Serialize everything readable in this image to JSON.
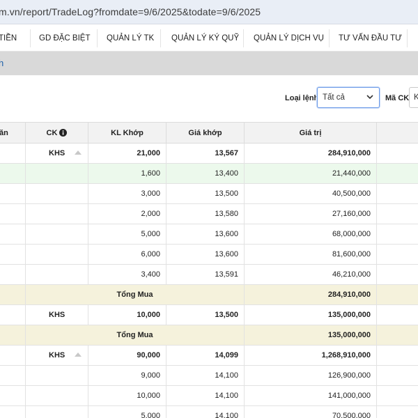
{
  "browser": {
    "url": "m.vn/report/TradeLog?fromdate=9/6/2025&todate=9/6/2025"
  },
  "nav": {
    "items": [
      "TIỀN",
      "GD ĐẶC BIỆT",
      "QUẢN LÝ TK",
      "QUẢN LÝ KÝ QUỸ",
      "QUẢN LÝ DỊCH VỤ",
      "TƯ VẤN ĐẦU TƯ"
    ]
  },
  "breadcrumb": "h",
  "filters": {
    "order_type_label": "Loại lệnh",
    "order_type_value": "Tất cả",
    "symbol_label": "Mã CK",
    "symbol_value": "K"
  },
  "table": {
    "headers": {
      "col0": "ăn",
      "symbol": "CK",
      "qty": "KL Khớp",
      "price": "Giá khớp",
      "value": "Giá trị"
    },
    "rows": [
      {
        "kind": "group",
        "symbol": "KHS",
        "qty": "21,000",
        "price": "13,567",
        "value": "284,910,000",
        "sort": true
      },
      {
        "kind": "green",
        "symbol": "",
        "qty": "1,600",
        "price": "13,400",
        "value": "21,440,000"
      },
      {
        "kind": "detail",
        "symbol": "",
        "qty": "3,000",
        "price": "13,500",
        "value": "40,500,000"
      },
      {
        "kind": "detail",
        "symbol": "",
        "qty": "2,000",
        "price": "13,580",
        "value": "27,160,000"
      },
      {
        "kind": "detail",
        "symbol": "",
        "qty": "5,000",
        "price": "13,600",
        "value": "68,000,000"
      },
      {
        "kind": "detail",
        "symbol": "",
        "qty": "6,000",
        "price": "13,600",
        "value": "81,600,000"
      },
      {
        "kind": "detail",
        "symbol": "",
        "qty": "3,400",
        "price": "13,591",
        "value": "46,210,000"
      },
      {
        "kind": "total",
        "label": "Tổng Mua",
        "value": "284,910,000"
      },
      {
        "kind": "group",
        "symbol": "KHS",
        "qty": "10,000",
        "price": "13,500",
        "value": "135,000,000",
        "sort": false
      },
      {
        "kind": "total",
        "label": "Tổng Mua",
        "value": "135,000,000"
      },
      {
        "kind": "group",
        "symbol": "KHS",
        "qty": "90,000",
        "price": "14,099",
        "value": "1,268,910,000",
        "sort": true
      },
      {
        "kind": "detail",
        "symbol": "",
        "qty": "9,000",
        "price": "14,100",
        "value": "126,900,000"
      },
      {
        "kind": "detail",
        "symbol": "",
        "qty": "10,000",
        "price": "14,100",
        "value": "141,000,000"
      },
      {
        "kind": "detail",
        "symbol": "",
        "qty": "5,000",
        "price": "14,100",
        "value": "70,500,000"
      }
    ]
  },
  "colors": {
    "accent": "#1a5fa8",
    "green_row": "#ecf9ec",
    "total_row": "#f5f2dc",
    "header_bg": "#f2f2f2"
  }
}
